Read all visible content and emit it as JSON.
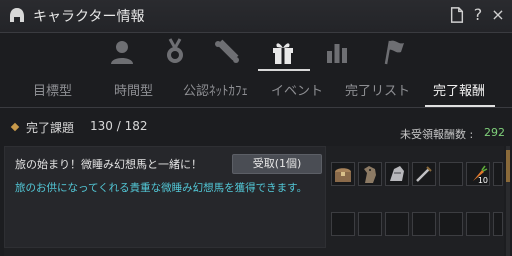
{
  "window": {
    "title": "キャラクター情報",
    "icons": [
      "helmet-icon",
      "document-icon",
      "help-icon",
      "close-icon"
    ],
    "help_glyph": "?",
    "close_glyph": "×"
  },
  "category_icons": [
    "person-icon",
    "medal-icon",
    "scroll-icon",
    "gift-icon",
    "bar-chart-icon",
    "flag-icon"
  ],
  "active_category": "gift-icon",
  "tabs": [
    {
      "label": "目標型"
    },
    {
      "label": "時間型"
    },
    {
      "label": "公認ﾈｯﾄｶﾌｪ"
    },
    {
      "label": "イベント"
    },
    {
      "label": "完了リスト"
    },
    {
      "label": "完了報酬"
    }
  ],
  "active_tab": "完了報酬",
  "summary": {
    "label": "完了課題",
    "count": "130 / 182",
    "unclaimed_label": "未受領報酬数 :",
    "unclaimed_count": "292"
  },
  "rows": [
    {
      "title": "旅の始まり！微睡み幻想馬と一緒に！",
      "button": "受取(1個)",
      "description": "旅のお供になってくれる貴重な微睡み幻想馬を獲得できます。",
      "reward_items": [
        "treasure-chest-icon",
        "horse-icon",
        "horse-armor-icon",
        "weapon-icon",
        "fishing-rod-icon",
        "carrot-icon",
        "empty-slot"
      ],
      "carrot_qty": "10"
    }
  ],
  "colors": {
    "accent_gold": "#c89a4a",
    "count_green": "#7fd07a",
    "description_cyan": "#52c7d6"
  }
}
